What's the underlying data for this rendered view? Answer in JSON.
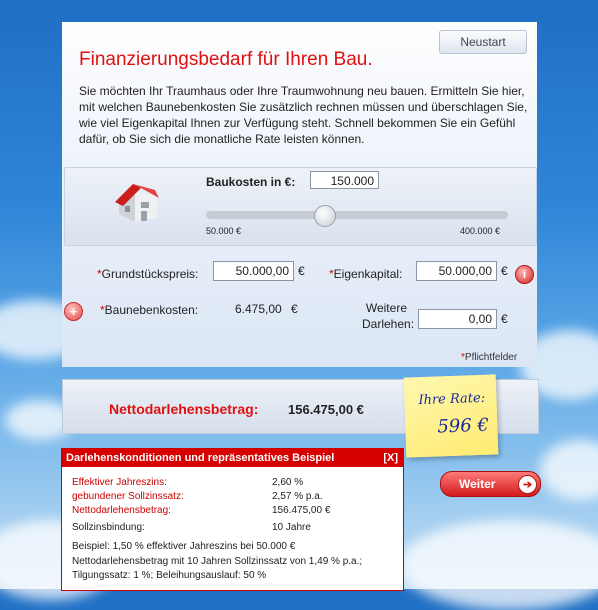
{
  "header": {
    "restart_label": "Neustart",
    "title": "Finanzierungsbedarf für Ihren Bau."
  },
  "intro": "Sie möchten Ihr Traumhaus oder Ihre Traumwohnung neu bauen. Ermitteln Sie hier, mit welchen Baunebenkosten Sie zusätzlich rechnen müssen und überschlagen Sie, wie viel Eigenkapital Ihnen zur Verfügung steht. Schnell bekommen Sie ein Gefühl dafür, ob Sie sich die monatliche Rate leisten können.",
  "baukosten": {
    "label": "Baukosten in €:",
    "value": "150.000",
    "min_label": "50.000 €",
    "max_label": "400.000 €",
    "slider_value": 150000,
    "slider_min": 50000,
    "slider_max": 400000
  },
  "fields": {
    "asterisk": "*",
    "euro": "€",
    "grund_label": "Grundstückspreis:",
    "grund_value": "50.000,00",
    "eigen_label": "Eigenkapital:",
    "eigen_value": "50.000,00",
    "neben_label": "Baunebenkosten:",
    "neben_value": "6.475,00",
    "darlehen_label_1": "Weitere",
    "darlehen_label_2": "Darlehen:",
    "darlehen_value": "0,00",
    "pflicht_label": "Pflichtfelder"
  },
  "icons": {
    "info": "i",
    "plus": "+",
    "arrow": "➔"
  },
  "net": {
    "label": "Nettodarlehensbetrag:",
    "value": "156.475,00 €"
  },
  "rate": {
    "label": "Ihre Rate:",
    "value": "596 €"
  },
  "conditions": {
    "title": "Darlehenskonditionen und repräsentatives Beispiel",
    "close": "[X]",
    "rows": [
      {
        "label": "Effektiver Jahreszins:",
        "value": "2,60 %"
      },
      {
        "label": "gebundener Sollzinssatz:",
        "value": "2,57 % p.a."
      },
      {
        "label": "Nettodarlehensbetrag:",
        "value": "156.475,00 €"
      },
      {
        "label": "Sollzinsbindung:",
        "value": "10 Jahre"
      }
    ],
    "example_1": "Beispiel: 1,50 % effektiver Jahreszins bei 50.000 €",
    "example_2": "Nettodarlehensbetrag mit 10 Jahren Sollzinssatz von 1,49 % p.a.;",
    "example_3": "Tilgungssatz: 1 %; Beleihungsauslauf: 50 %"
  },
  "weiter_label": "Weiter",
  "colors": {
    "accent": "#e01010",
    "rate_ink": "#1b2a9a",
    "postit": "#fff3a0",
    "sky": "#2f86d8"
  }
}
